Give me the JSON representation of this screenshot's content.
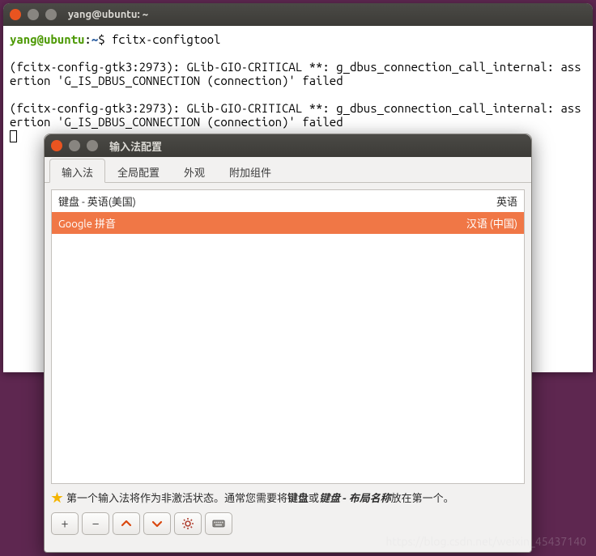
{
  "terminal": {
    "title": "yang@ubuntu: ~",
    "prompt_user": "yang@ubuntu",
    "prompt_sep": ":",
    "prompt_path": "~",
    "prompt_dollar": "$ ",
    "command": "fcitx-configtool",
    "blank": "",
    "line1": "(fcitx-config-gtk3:2973): GLib-GIO-CRITICAL **: g_dbus_connection_call_internal: assertion 'G_IS_DBUS_CONNECTION (connection)' failed",
    "line2": "(fcitx-config-gtk3:2973): GLib-GIO-CRITICAL **: g_dbus_connection_call_internal: assertion 'G_IS_DBUS_CONNECTION (connection)' failed"
  },
  "config": {
    "title": "输入法配置",
    "tabs": [
      "输入法",
      "全局配置",
      "外观",
      "附加组件"
    ],
    "list": [
      {
        "name": "键盘 - 英语(美国)",
        "lang": "英语",
        "selected": false
      },
      {
        "name": "Google 拼音",
        "lang": "汉语 (中国)",
        "selected": true
      }
    ],
    "hint_pre": "第一个输入法将作为非激活状态。通常您需要将",
    "hint_bold1": "键盘",
    "hint_mid": "或",
    "hint_bold2": "键盘 - 布局名称",
    "hint_post": "放在第一个。",
    "toolbar": {
      "add": "+",
      "remove": "−",
      "up": "up-icon",
      "down": "down-icon",
      "settings": "settings-icon",
      "keyboard": "keyboard-icon"
    }
  },
  "watermark": "https://blog.csdn.net/weixin_45437140"
}
